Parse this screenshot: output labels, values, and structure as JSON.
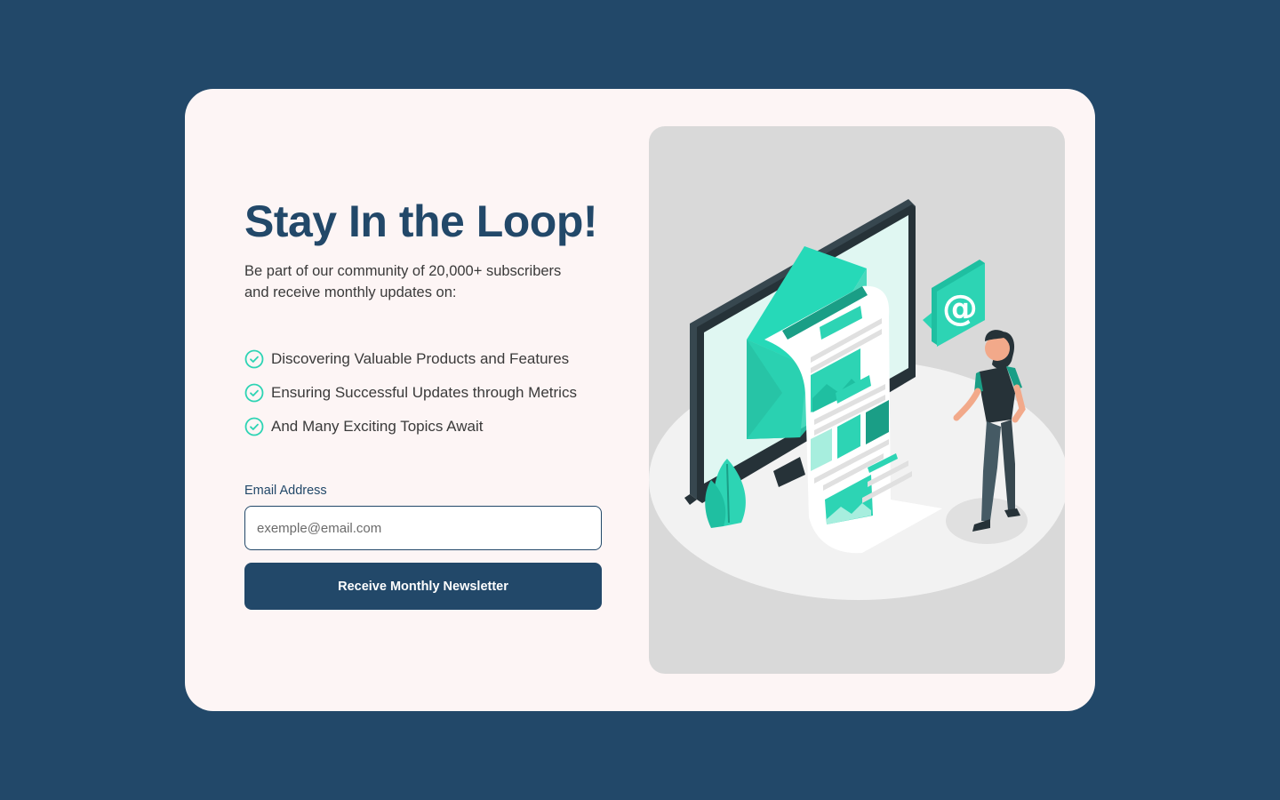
{
  "signup": {
    "title": "Stay In the Loop!",
    "subtitle": "Be part of our community of 20,000+ subscribers and receive monthly updates on:",
    "features": [
      {
        "label": "Discovering Valuable Products and Features",
        "icon": "check-circle-icon"
      },
      {
        "label": "Ensuring Successful Updates through Metrics",
        "icon": "check-circle-icon"
      },
      {
        "label": "And Many Exciting Topics Await",
        "icon": "check-circle-icon"
      }
    ],
    "email_label": "Email Address",
    "email_placeholder": "exemple@email.com",
    "email_value": "",
    "submit_label": "Receive Monthly Newsletter"
  },
  "colors": {
    "background": "#224869",
    "card": "#fdf5f5",
    "primary": "#224869",
    "accent": "#2dd4b4",
    "illustration_bg": "#d9d9d9"
  },
  "illustration": {
    "subject": "newsletter-illustration",
    "icons": [
      "monitor-icon",
      "envelope-icon",
      "at-sign-icon",
      "person-icon",
      "plant-icon"
    ]
  }
}
